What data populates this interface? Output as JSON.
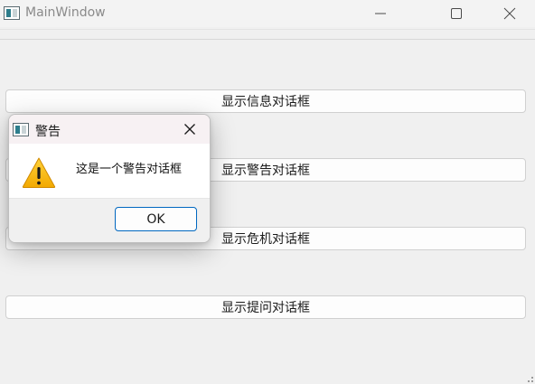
{
  "window": {
    "title": "MainWindow",
    "icon": "app-window-icon"
  },
  "caption_buttons": {
    "minimize": "minimize-icon",
    "maximize": "maximize-icon",
    "close": "close-icon"
  },
  "buttons": [
    {
      "label": "显示信息对话框"
    },
    {
      "label": "显示警告对话框"
    },
    {
      "label": "显示危机对话框"
    },
    {
      "label": "显示提问对话框"
    }
  ],
  "dialog": {
    "title": "警告",
    "message": "这是一个警告对话框",
    "icon": "warning-icon",
    "ok_label": "OK",
    "accent_color": "#0067c0"
  }
}
